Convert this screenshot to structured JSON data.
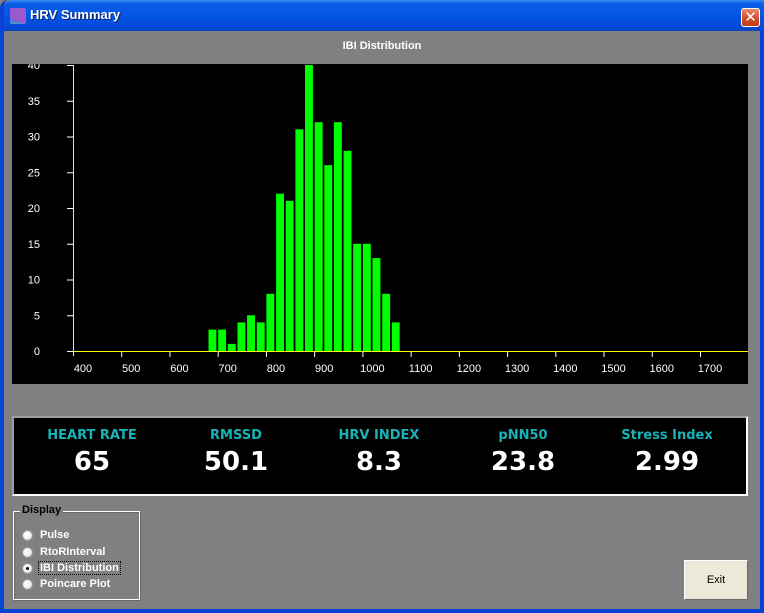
{
  "window": {
    "title": "HRV Summary",
    "close_label": "✕"
  },
  "chart_data": {
    "type": "bar",
    "title": "IBI Distribution",
    "xlabel": "",
    "ylabel": "",
    "xlim": [
      400,
      1780
    ],
    "ylim": [
      0,
      40
    ],
    "bin_width": 20,
    "x_ticks": [
      400,
      500,
      600,
      700,
      800,
      900,
      1000,
      1100,
      1200,
      1300,
      1400,
      1500,
      1600,
      1700
    ],
    "y_ticks": [
      0,
      5,
      10,
      15,
      20,
      25,
      30,
      35,
      40
    ],
    "categories": [
      680,
      700,
      720,
      740,
      760,
      780,
      800,
      820,
      840,
      860,
      880,
      900,
      920,
      940,
      960,
      980,
      1000,
      1020,
      1040,
      1060
    ],
    "values": [
      3,
      3,
      1,
      4,
      5,
      4,
      8,
      22,
      21,
      31,
      40,
      32,
      26,
      32,
      28,
      15,
      15,
      13,
      8,
      4
    ],
    "colors": {
      "bar": "#00ff00",
      "axis": "#ffff00",
      "tick_label": "#ffffff",
      "background": "#000000"
    },
    "grid": false,
    "legend": "none"
  },
  "stats": [
    {
      "label": "HEART RATE",
      "value": "65"
    },
    {
      "label": "RMSSD",
      "value": "50.1"
    },
    {
      "label": "HRV INDEX",
      "value": "8.3"
    },
    {
      "label": "pNN50",
      "value": "23.8"
    },
    {
      "label": "Stress Index",
      "value": "2.99"
    }
  ],
  "display": {
    "legend": "Display",
    "options": [
      {
        "label": "Pulse",
        "checked": false
      },
      {
        "label": "RtoRInterval",
        "checked": false
      },
      {
        "label": "IBI Distribution",
        "checked": true
      },
      {
        "label": "Poincare Plot",
        "checked": false
      }
    ]
  },
  "buttons": {
    "exit_label": "Exit"
  },
  "colors": {
    "titlebar": "#0556e4",
    "client_bg": "#808080",
    "stat_label": "#17b3b8",
    "stat_value": "#ffffff"
  }
}
